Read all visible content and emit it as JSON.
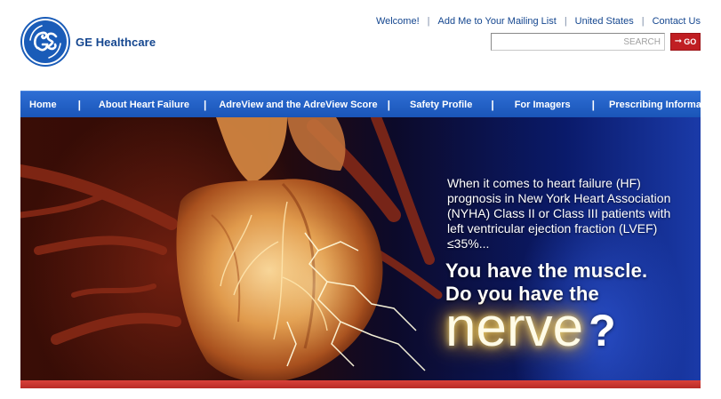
{
  "brand": {
    "name": "GE Healthcare",
    "logo_icon": "ge-monogram-icon",
    "logo_color": "#1a5cb8"
  },
  "top_links": [
    "Welcome!",
    "Add Me to Your Mailing List",
    "United States",
    "Contact Us"
  ],
  "search": {
    "placeholder": "SEARCH",
    "go_label": "GO",
    "go_icon": "arrow-right-icon",
    "go_color": "#c01e23"
  },
  "nav": {
    "items": [
      "Home",
      "About Heart Failure",
      "AdreView and the AdreView Score",
      "Safety Profile",
      "For Imagers",
      "Prescribing Information"
    ],
    "background": "#1f5fc4"
  },
  "hero": {
    "intro": "When it comes to heart failure (HF) prognosis in New York Heart Association (NYHA) Class II or Class III patients with left ventricular ejection fraction (LVEF) ≤35%...",
    "tagline_1": "You have the muscle.",
    "tagline_2": "Do you have the",
    "highlight_word": "nerve",
    "question_mark": "?",
    "accent_bar_color": "#c8332d"
  }
}
